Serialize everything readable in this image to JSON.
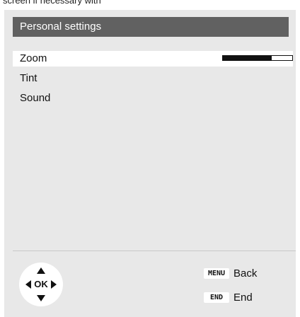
{
  "top_caption": "screen if necessary with",
  "header": {
    "title": "Personal settings"
  },
  "menu": {
    "items": [
      {
        "label": "Zoom",
        "selected": true,
        "level": 0.7
      },
      {
        "label": "Tint",
        "selected": false
      },
      {
        "label": "Sound",
        "selected": false
      }
    ]
  },
  "footer": {
    "dpad": {
      "center_label": "OK"
    },
    "keys": [
      {
        "key": "MENU",
        "label": "Back"
      },
      {
        "key": "END",
        "label": "End"
      }
    ]
  },
  "colors": {
    "panel_background": "#e8e8e8",
    "header_background": "#616161",
    "selected_row": "#ffffff"
  }
}
